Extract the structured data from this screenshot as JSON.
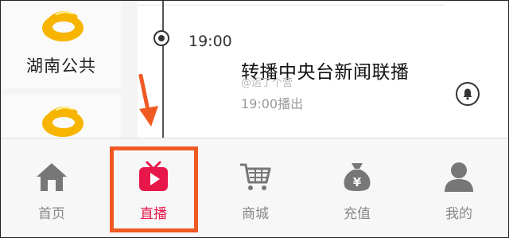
{
  "channels": [
    {
      "name": "湖南公共",
      "logo_icon": "mango-tv-logo-icon"
    },
    {
      "name": "",
      "logo_icon": "mango-tv-logo-icon"
    }
  ],
  "program": {
    "time": "19:00",
    "title": "转播中央台新闻联播",
    "watermark": "@运了个营",
    "subtitle": "19:00播出",
    "reminder_icon": "bell-icon"
  },
  "nav": {
    "items": [
      {
        "label": "首页",
        "icon": "home-icon",
        "active": false
      },
      {
        "label": "直播",
        "icon": "tv-play-icon",
        "active": true
      },
      {
        "label": "商城",
        "icon": "cart-icon",
        "active": false
      },
      {
        "label": "充值",
        "icon": "money-bag-icon",
        "active": false
      },
      {
        "label": "我的",
        "icon": "user-icon",
        "active": false
      }
    ]
  },
  "colors": {
    "accent": "#e8174a",
    "highlight": "#f05a22",
    "logo_yellow": "#f7b500",
    "icon_gray": "#777777"
  }
}
